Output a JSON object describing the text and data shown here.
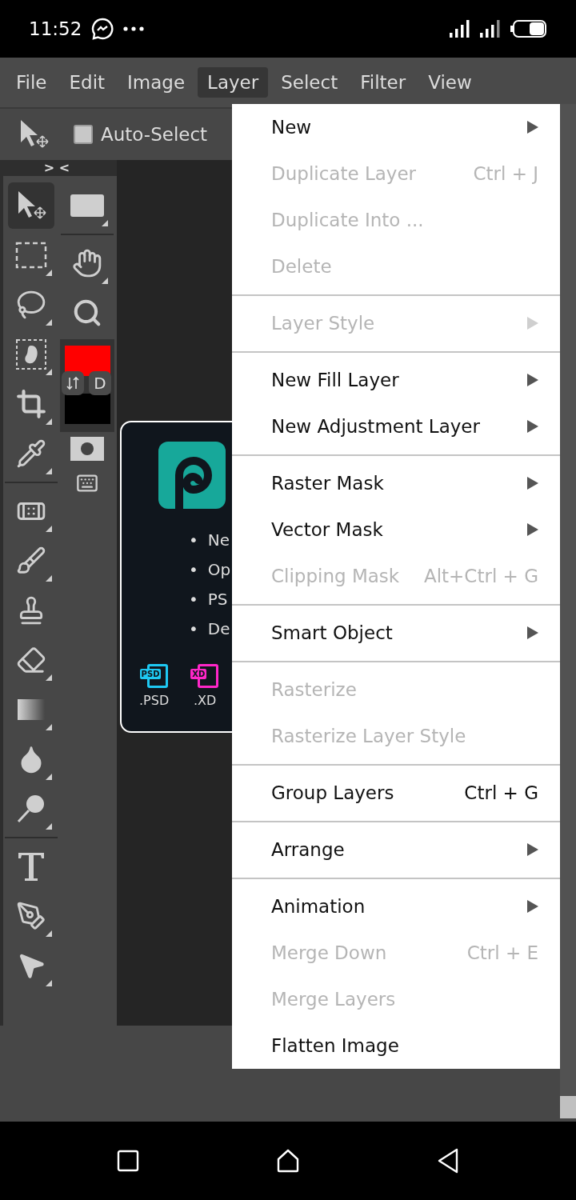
{
  "status_bar": {
    "time": "11:52"
  },
  "menu_bar": {
    "items": [
      {
        "label": "File",
        "selected": false
      },
      {
        "label": "Edit",
        "selected": false
      },
      {
        "label": "Image",
        "selected": false
      },
      {
        "label": "Layer",
        "selected": true
      },
      {
        "label": "Select",
        "selected": false
      },
      {
        "label": "Filter",
        "selected": false
      },
      {
        "label": "View",
        "selected": false
      }
    ]
  },
  "options_bar": {
    "auto_select": {
      "label": "Auto-Select",
      "checked": false
    }
  },
  "toolbar": {
    "collapse": "> <",
    "tools": [
      {
        "kind": "move",
        "selected": true,
        "flyout": false
      },
      {
        "kind": "marquee",
        "selected": false,
        "flyout": true
      },
      {
        "kind": "lasso",
        "selected": false,
        "flyout": true
      },
      {
        "kind": "quick-select",
        "selected": false,
        "flyout": true
      },
      {
        "kind": "crop",
        "selected": false,
        "flyout": true
      },
      {
        "kind": "eyedropper",
        "selected": false,
        "flyout": true
      },
      {
        "kind": "divider"
      },
      {
        "kind": "healing",
        "selected": false,
        "flyout": true
      },
      {
        "kind": "brush",
        "selected": false,
        "flyout": true
      },
      {
        "kind": "stamp",
        "selected": false,
        "flyout": false
      },
      {
        "kind": "eraser",
        "selected": false,
        "flyout": true
      },
      {
        "kind": "gradient",
        "selected": false,
        "flyout": true
      },
      {
        "kind": "blur",
        "selected": false,
        "flyout": true
      },
      {
        "kind": "dodge",
        "selected": false,
        "flyout": true
      },
      {
        "kind": "divider"
      },
      {
        "kind": "type",
        "selected": false,
        "flyout": false
      },
      {
        "kind": "pen",
        "selected": false,
        "flyout": true
      },
      {
        "kind": "path-select",
        "selected": false,
        "flyout": true
      }
    ],
    "side_tools": [
      {
        "kind": "shape",
        "selected": false,
        "flyout": true
      },
      {
        "kind": "hand",
        "selected": false,
        "flyout": true
      },
      {
        "kind": "zoom",
        "selected": false,
        "flyout": false
      }
    ],
    "swatches": [
      {
        "color": "#ff0000"
      },
      {
        "color": "#000000"
      }
    ],
    "default_colors": "D",
    "extras": [
      {
        "kind": "quick-mask"
      },
      {
        "kind": "keyboard"
      }
    ]
  },
  "card": {
    "bullets": [
      {
        "marker": "•",
        "text": "Ne"
      },
      {
        "marker": "•",
        "text": "Op"
      },
      {
        "marker": "•",
        "text": "PS"
      },
      {
        "marker": "•",
        "text": "De"
      }
    ],
    "files": [
      {
        "badge": "PSD",
        "label": ".PSD",
        "color": "#1ec8f2"
      },
      {
        "badge": "XD",
        "label": ".XD",
        "color": "#ff26c8"
      }
    ]
  },
  "layer_menu": {
    "groups": [
      {
        "items": [
          {
            "label": "New",
            "kind": "submenu",
            "disabled": false
          },
          {
            "label": "Duplicate Layer",
            "kind": "shortcut",
            "shortcut": "Ctrl + J",
            "disabled": true
          },
          {
            "label": "Duplicate Into ...",
            "kind": "plain",
            "disabled": true
          },
          {
            "label": "Delete",
            "kind": "plain",
            "disabled": true
          }
        ]
      },
      {
        "items": [
          {
            "label": "Layer Style",
            "kind": "submenu",
            "disabled": true
          }
        ]
      },
      {
        "items": [
          {
            "label": "New Fill Layer",
            "kind": "submenu",
            "disabled": false
          },
          {
            "label": "New Adjustment Layer",
            "kind": "submenu",
            "disabled": false
          }
        ]
      },
      {
        "items": [
          {
            "label": "Raster Mask",
            "kind": "submenu",
            "disabled": false
          },
          {
            "label": "Vector Mask",
            "kind": "submenu",
            "disabled": false
          },
          {
            "label": "Clipping Mask",
            "kind": "shortcut",
            "shortcut": "Alt+Ctrl + G",
            "disabled": true
          }
        ]
      },
      {
        "items": [
          {
            "label": "Smart Object",
            "kind": "submenu",
            "disabled": false
          }
        ]
      },
      {
        "items": [
          {
            "label": "Rasterize",
            "kind": "plain",
            "disabled": true
          },
          {
            "label": "Rasterize Layer Style",
            "kind": "plain",
            "disabled": true
          }
        ]
      },
      {
        "items": [
          {
            "label": "Group Layers",
            "kind": "shortcut",
            "shortcut": "Ctrl + G",
            "disabled": false
          }
        ]
      },
      {
        "items": [
          {
            "label": "Arrange",
            "kind": "submenu",
            "disabled": false
          }
        ]
      },
      {
        "items": [
          {
            "label": "Animation",
            "kind": "submenu",
            "disabled": false
          },
          {
            "label": "Merge Down",
            "kind": "shortcut",
            "shortcut": "Ctrl + E",
            "disabled": true
          },
          {
            "label": "Merge Layers",
            "kind": "plain",
            "disabled": true
          },
          {
            "label": "Flatten Image",
            "kind": "plain",
            "disabled": false
          }
        ]
      }
    ]
  }
}
